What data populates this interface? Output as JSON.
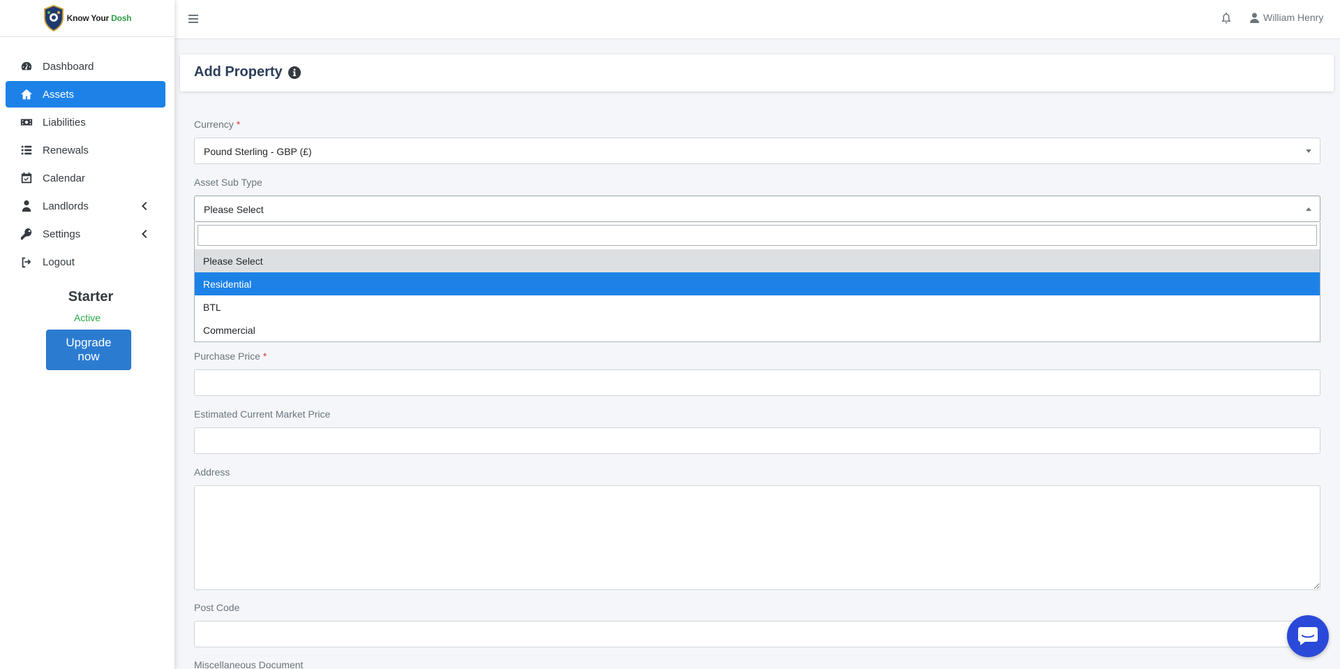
{
  "brand": {
    "name_prefix": "Know Your ",
    "name_accent": "Dosh"
  },
  "sidebar": {
    "items": [
      {
        "label": "Dashboard",
        "icon": "tachometer-icon"
      },
      {
        "label": "Assets",
        "icon": "home-icon"
      },
      {
        "label": "Liabilities",
        "icon": "money-bill-icon"
      },
      {
        "label": "Renewals",
        "icon": "list-icon"
      },
      {
        "label": "Calendar",
        "icon": "calendar-check-icon"
      },
      {
        "label": "Landlords",
        "icon": "user-tie-icon"
      },
      {
        "label": "Settings",
        "icon": "key-icon"
      },
      {
        "label": "Logout",
        "icon": "sign-out-icon"
      }
    ],
    "plan": {
      "name": "Starter",
      "status": "Active",
      "upgrade_label": "Upgrade now"
    }
  },
  "topbar": {
    "user_name": "William Henry"
  },
  "page": {
    "title": "Add Property"
  },
  "form": {
    "currency": {
      "label": "Currency",
      "required_mark": "*",
      "value": "Pound Sterling - GBP (£)"
    },
    "asset_sub_type": {
      "label": "Asset Sub Type",
      "value": "Please Select",
      "search_value": "",
      "options": [
        "Please Select",
        "Residential",
        "BTL",
        "Commercial"
      ],
      "hover_option": "Please Select",
      "selected_option": "Residential"
    },
    "purchase_price": {
      "label": "Purchase Price",
      "required_mark": "*",
      "value": ""
    },
    "market_price": {
      "label": "Estimated Current Market Price",
      "value": ""
    },
    "address": {
      "label": "Address",
      "value": ""
    },
    "post_code": {
      "label": "Post Code",
      "value": ""
    },
    "misc_document": {
      "label": "Miscellaneous Document"
    }
  },
  "colors": {
    "primary": "#1d82e8",
    "success": "#28a745",
    "danger": "#dc3545",
    "chat": "#2a49d8"
  }
}
